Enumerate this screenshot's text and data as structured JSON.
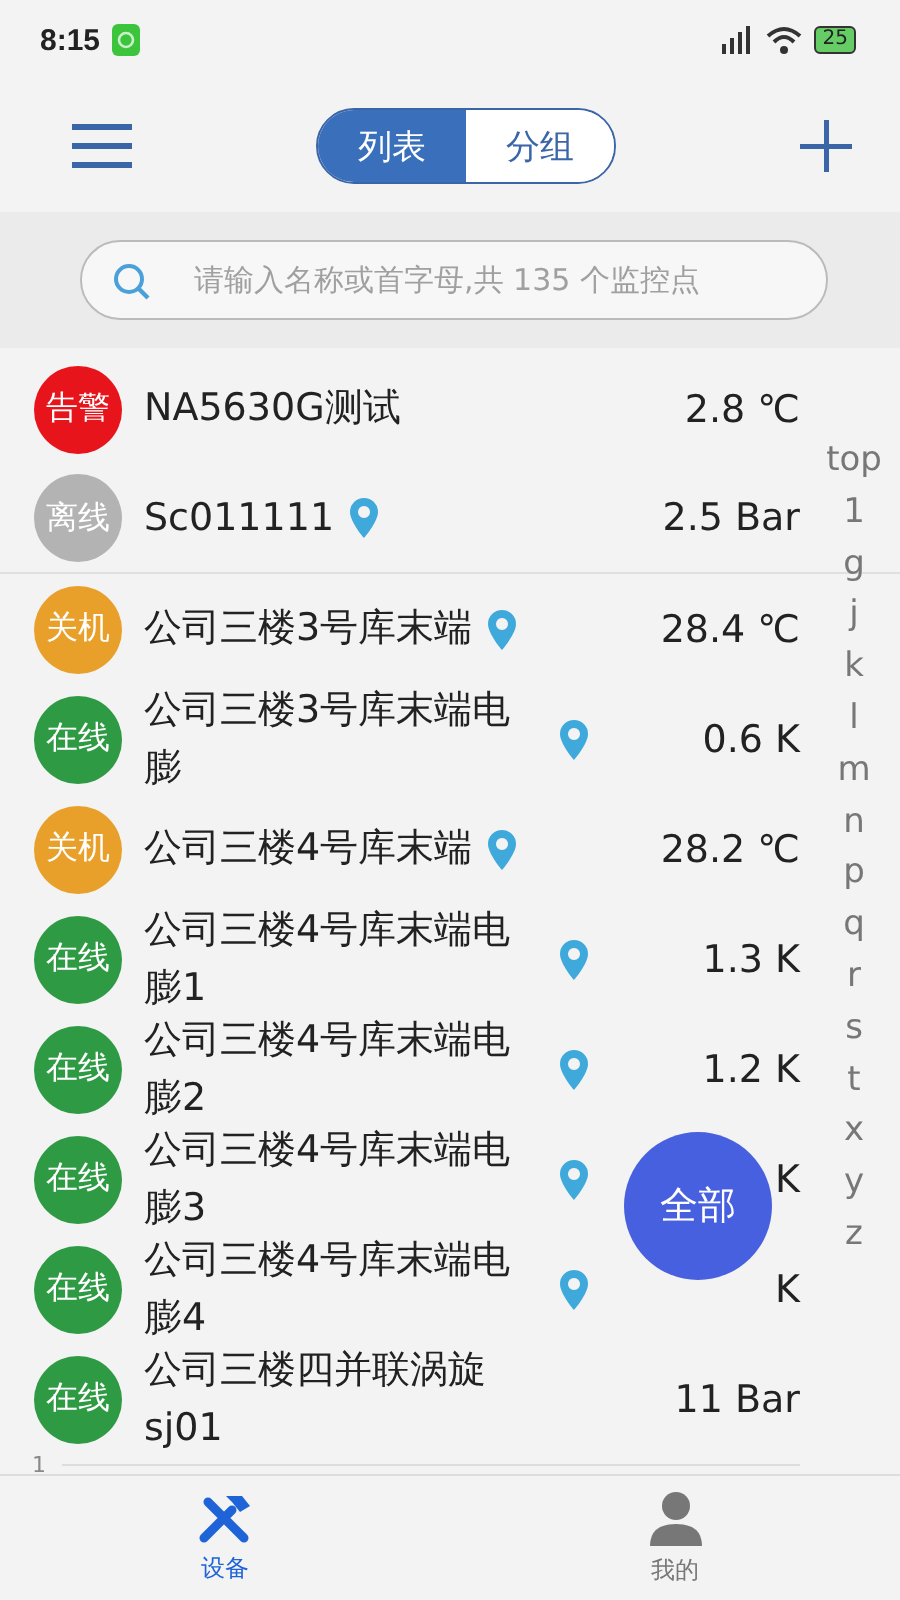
{
  "status_bar": {
    "time": "8:15",
    "battery": "25"
  },
  "header": {
    "segments": [
      {
        "label": "列表",
        "selected": true
      },
      {
        "label": "分组",
        "selected": false
      }
    ]
  },
  "search": {
    "placeholder": "请输入名称或首字母,共 135 个监控点"
  },
  "devices": [
    {
      "status": "告警",
      "color": "#e8141b",
      "name": "NA5630G测试",
      "located": false,
      "value": "2.8 ℃"
    },
    {
      "status": "离线",
      "color": "#b3b3b3",
      "name": "Sc011111",
      "located": true,
      "value": "2.5 Bar"
    },
    {
      "status": "关机",
      "color": "#e9a02a",
      "name": "公司三楼3号库末端",
      "located": true,
      "value": "28.4 ℃"
    },
    {
      "status": "在线",
      "color": "#2e9a44",
      "name": "公司三楼3号库末端电膨",
      "located": true,
      "value": "0.6 K"
    },
    {
      "status": "关机",
      "color": "#e9a02a",
      "name": "公司三楼4号库末端",
      "located": true,
      "value": "28.2 ℃"
    },
    {
      "status": "在线",
      "color": "#2e9a44",
      "name": "公司三楼4号库末端电膨1",
      "located": true,
      "value": "1.3 K"
    },
    {
      "status": "在线",
      "color": "#2e9a44",
      "name": "公司三楼4号库末端电膨2",
      "located": true,
      "value": "1.2 K"
    },
    {
      "status": "在线",
      "color": "#2e9a44",
      "name": "公司三楼4号库末端电膨3",
      "located": true,
      "value": "K"
    },
    {
      "status": "在线",
      "color": "#2e9a44",
      "name": "公司三楼4号库末端电膨4",
      "located": true,
      "value": "K"
    },
    {
      "status": "在线",
      "color": "#2e9a44",
      "name": "公司三楼四并联涡旋sj01",
      "located": false,
      "value": "11 Bar"
    }
  ],
  "index": [
    "top",
    "1",
    "g",
    "j",
    "k",
    "l",
    "m",
    "n",
    "p",
    "q",
    "r",
    "s",
    "t",
    "x",
    "y",
    "z"
  ],
  "fab": "全部",
  "footer_mark": "1",
  "tabs": [
    {
      "label": "设备",
      "selected": true,
      "kind": "tools"
    },
    {
      "label": "我的",
      "selected": false,
      "kind": "person"
    }
  ]
}
